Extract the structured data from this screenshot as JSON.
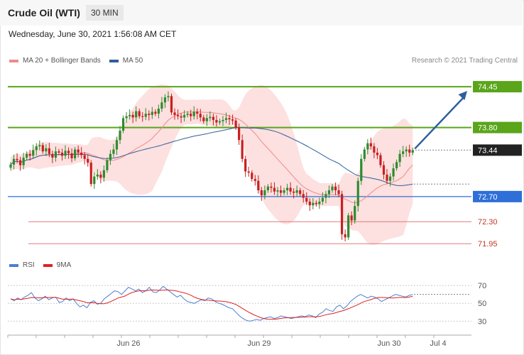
{
  "header": {
    "instrument": "Crude Oil (WTI)",
    "timeframe": "30 MIN"
  },
  "date": "Wednesday, June 30, 2021 1:56:08 AM CET",
  "research_note": "Research © 2021 Trading Central",
  "legend_main": [
    {
      "label": "MA 20 + Bollinger Bands",
      "color": "#f08a8a"
    },
    {
      "label": "MA 50",
      "color": "#2f5f9a"
    }
  ],
  "legend_rsi": [
    {
      "label": "RSI",
      "color": "#4b7fd1"
    },
    {
      "label": "9MA",
      "color": "#e02020"
    }
  ],
  "colors": {
    "up": "#2e8b2e",
    "down": "#c91f1f",
    "resistance": "#5aa51a",
    "support": "#2e6fd8",
    "support_thin": "#e07a7a",
    "current": "#222222",
    "arrow": "#2f5f9a"
  },
  "chart_data": {
    "type": "candlestick",
    "ylim": [
      71.76,
      74.7
    ],
    "x_ticks": [
      "Jun 26",
      "Jun 29",
      "Jun 30",
      "Jul 4"
    ],
    "levels": [
      {
        "value": 74.45,
        "label": "74.45",
        "kind": "resistance"
      },
      {
        "value": 73.8,
        "label": "73.80",
        "kind": "resistance"
      },
      {
        "value": 73.44,
        "label": "73.44",
        "kind": "current"
      },
      {
        "value": 72.7,
        "label": "72.70",
        "kind": "support"
      },
      {
        "value": 72.3,
        "label": "72.30",
        "kind": "support_thin"
      },
      {
        "value": 71.95,
        "label": "71.95",
        "kind": "support_thin"
      }
    ],
    "forecast": {
      "from": 73.44,
      "to": 74.45
    },
    "closes": [
      73.21,
      73.3,
      73.28,
      73.2,
      73.32,
      73.38,
      73.35,
      73.44,
      73.5,
      73.52,
      73.42,
      73.47,
      73.38,
      73.32,
      73.42,
      73.4,
      73.35,
      73.43,
      73.39,
      73.31,
      73.45,
      73.4,
      73.36,
      73.3,
      73.24,
      72.9,
      73.02,
      73.05,
      73.0,
      73.12,
      73.28,
      73.38,
      73.45,
      73.6,
      73.75,
      73.95,
      73.98,
      74.0,
      73.96,
      74.06,
      73.98,
      73.97,
      74.02,
      74.0,
      74.05,
      74.02,
      74.1,
      74.2,
      74.28,
      74.3,
      74.04,
      74.0,
      73.98,
      73.96,
      74.0,
      74.02,
      73.98,
      74.05,
      74.02,
      73.96,
      73.9,
      73.95,
      73.97,
      73.92,
      73.88,
      73.9,
      73.92,
      73.95,
      73.93,
      73.91,
      73.8,
      73.6,
      73.3,
      73.1,
      73.08,
      72.98,
      72.95,
      72.8,
      72.72,
      72.8,
      72.86,
      72.84,
      72.78,
      72.8,
      72.76,
      72.8,
      72.84,
      72.78,
      72.76,
      72.8,
      72.74,
      72.68,
      72.62,
      72.56,
      72.6,
      72.58,
      72.62,
      72.68,
      72.74,
      72.8,
      72.86,
      72.8,
      72.74,
      72.1,
      72.05,
      72.4,
      72.32,
      72.55,
      72.95,
      73.3,
      73.45,
      73.55,
      73.5,
      73.4,
      73.36,
      73.2,
      73.05,
      72.95,
      73.02,
      73.15,
      73.25,
      73.38,
      73.42,
      73.45,
      73.4,
      73.44
    ],
    "rsi": [
      55,
      53,
      56,
      54,
      57,
      59,
      62,
      56,
      53,
      55,
      58,
      54,
      56,
      57,
      51,
      52,
      56,
      53,
      55,
      50,
      46,
      48,
      45,
      51,
      53,
      49,
      50,
      55,
      58,
      61,
      64,
      63,
      60,
      64,
      68,
      66,
      64,
      66,
      62,
      64,
      68,
      63,
      62,
      65,
      69,
      66,
      63,
      60,
      57,
      59,
      55,
      52,
      51,
      50,
      52,
      54,
      53,
      56,
      55,
      52,
      50,
      49,
      47,
      45,
      44,
      40,
      36,
      33,
      31,
      30,
      31,
      32,
      31,
      33,
      34,
      35,
      33,
      34,
      36,
      35,
      34,
      33,
      34,
      35,
      36,
      35,
      37,
      36,
      34,
      38,
      40,
      44,
      42,
      41,
      46,
      48,
      44,
      47,
      52,
      55,
      58,
      60,
      58,
      56,
      58,
      57,
      55,
      52,
      54,
      56,
      58,
      60,
      59,
      58,
      57,
      59,
      60
    ],
    "rsi_ticks": [
      70,
      50,
      30
    ],
    "rsi_ylim": [
      20,
      78
    ]
  }
}
